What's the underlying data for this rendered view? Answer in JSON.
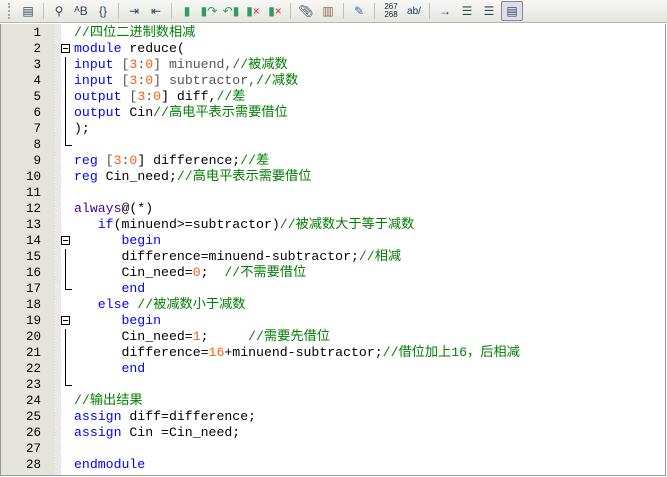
{
  "toolbar": {
    "items": [
      "print-preview",
      "find",
      "spell-check",
      "bracket-jump",
      "indent",
      "unindent",
      "bookmark",
      "next-bookmark",
      "prev-bookmark",
      "clear-bookmark",
      "clear-all-bookmarks",
      "attach",
      "scroll",
      "edit",
      "line-numbers",
      "word-wrap",
      "show-whitespace",
      "format-left",
      "format-right",
      "column-mode"
    ],
    "line_numbers_label_top": "267",
    "line_numbers_label_bottom": "268",
    "wrap_label": "ab/"
  },
  "code": {
    "lines": [
      [
        [
          "//四位二进制数相减",
          "cm"
        ]
      ],
      [
        [
          "module",
          "kw"
        ],
        [
          " reduce(",
          ""
        ]
      ],
      [
        [
          "input",
          "kw"
        ],
        [
          " [",
          "br"
        ],
        [
          "3",
          "num"
        ],
        [
          ":",
          "br"
        ],
        [
          "0",
          "num"
        ],
        [
          "] minuend,",
          "br"
        ],
        [
          "//被减数",
          "cm"
        ]
      ],
      [
        [
          "input",
          "kw"
        ],
        [
          " [",
          "br"
        ],
        [
          "3",
          "num"
        ],
        [
          ":",
          "br"
        ],
        [
          "0",
          "num"
        ],
        [
          "] subtractor,",
          "br"
        ],
        [
          "//减数",
          "cm"
        ]
      ],
      [
        [
          "output",
          "kw"
        ],
        [
          " [",
          "br"
        ],
        [
          "3",
          "num"
        ],
        [
          ":",
          "br"
        ],
        [
          "0",
          "num"
        ],
        [
          "] diff,",
          ""
        ],
        [
          "//差",
          "cm"
        ]
      ],
      [
        [
          "output",
          "kw"
        ],
        [
          " Cin",
          ""
        ],
        [
          "//高电平表示需要借位",
          "cm"
        ]
      ],
      [
        [
          ");",
          ""
        ]
      ],
      [],
      [
        [
          "reg",
          "kw"
        ],
        [
          " [",
          "br"
        ],
        [
          "3",
          "num"
        ],
        [
          ":",
          "br"
        ],
        [
          "0",
          "num"
        ],
        [
          "] difference;",
          ""
        ],
        [
          "//差",
          "cm"
        ]
      ],
      [
        [
          "reg",
          "kw"
        ],
        [
          " Cin_need;",
          ""
        ],
        [
          "//高电平表示需要借位",
          "cm"
        ]
      ],
      [],
      [
        [
          "always",
          "alw"
        ],
        [
          "@(*)",
          ""
        ]
      ],
      [
        [
          "   ",
          ""
        ],
        [
          "if",
          "kw"
        ],
        [
          "(minuend>=subtractor)",
          ""
        ],
        [
          "//被减数大于等于减数",
          "cm"
        ]
      ],
      [
        [
          "      ",
          ""
        ],
        [
          "begin",
          "kw"
        ]
      ],
      [
        [
          "      difference=minuend-subtractor;",
          ""
        ],
        [
          "//相减",
          "cm"
        ]
      ],
      [
        [
          "      Cin_need=",
          ""
        ],
        [
          "0",
          "num"
        ],
        [
          ";  ",
          ""
        ],
        [
          "//不需要借位",
          "cm"
        ]
      ],
      [
        [
          "      ",
          ""
        ],
        [
          "end",
          "kw"
        ]
      ],
      [
        [
          "   ",
          ""
        ],
        [
          "else",
          "kw"
        ],
        [
          " ",
          ""
        ],
        [
          "//被减数小于减数",
          "cm"
        ]
      ],
      [
        [
          "      ",
          ""
        ],
        [
          "begin",
          "kw"
        ]
      ],
      [
        [
          "      Cin_need=",
          ""
        ],
        [
          "1",
          "num"
        ],
        [
          ";     ",
          ""
        ],
        [
          "//需要先借位",
          "cm"
        ]
      ],
      [
        [
          "      difference=",
          ""
        ],
        [
          "16",
          "num"
        ],
        [
          "+minuend-subtractor;",
          ""
        ],
        [
          "//借位加上16，后相减",
          "cm"
        ]
      ],
      [
        [
          "      ",
          ""
        ],
        [
          "end",
          "kw"
        ]
      ],
      [],
      [
        [
          "//输出结果",
          "cm"
        ]
      ],
      [
        [
          "assign",
          "kw"
        ],
        [
          " diff=difference;",
          ""
        ]
      ],
      [
        [
          "assign",
          "kw"
        ],
        [
          " Cin =Cin_need;",
          ""
        ]
      ],
      [],
      [
        [
          "endmodule",
          "kw"
        ]
      ]
    ],
    "numbers": [
      "1",
      "2",
      "3",
      "4",
      "5",
      "6",
      "7",
      "8",
      "9",
      "10",
      "11",
      "12",
      "13",
      "14",
      "15",
      "16",
      "17",
      "18",
      "19",
      "20",
      "21",
      "22",
      "23",
      "24",
      "25",
      "26",
      "27",
      "28"
    ]
  }
}
